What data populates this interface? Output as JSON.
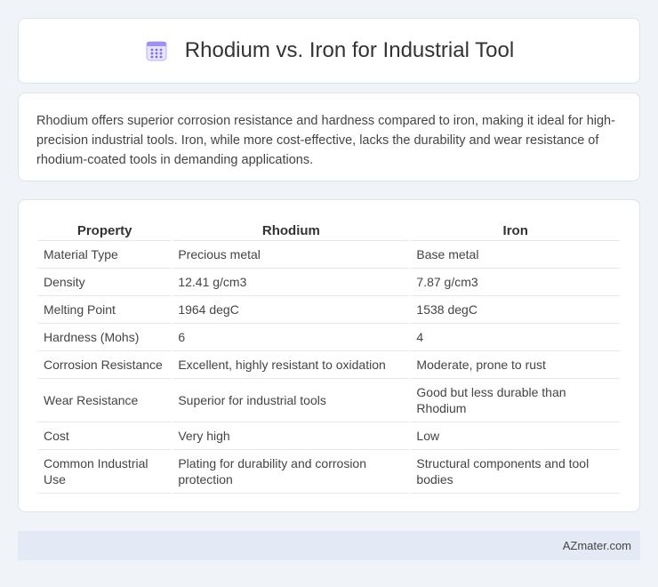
{
  "header": {
    "title": "Rhodium vs. Iron for Industrial Tool",
    "icon": "calendar-grid-icon",
    "icon_color": "#7a6cf0"
  },
  "summary": {
    "text": "Rhodium offers superior corrosion resistance and hardness compared to iron, making it ideal for high-precision industrial tools. Iron, while more cost-effective, lacks the durability and wear resistance of rhodium-coated tools in demanding applications."
  },
  "table": {
    "headers": [
      "Property",
      "Rhodium",
      "Iron"
    ],
    "rows": [
      [
        "Material Type",
        "Precious metal",
        "Base metal"
      ],
      [
        "Density",
        "12.41 g/cm3",
        "7.87 g/cm3"
      ],
      [
        "Melting Point",
        "1964 degC",
        "1538 degC"
      ],
      [
        "Hardness (Mohs)",
        "6",
        "4"
      ],
      [
        "Corrosion Resistance",
        "Excellent, highly resistant to oxidation",
        "Moderate, prone to rust"
      ],
      [
        "Wear Resistance",
        "Superior for industrial tools",
        "Good but less durable than Rhodium"
      ],
      [
        "Cost",
        "Very high",
        "Low"
      ],
      [
        "Common Industrial Use",
        "Plating for durability and corrosion protection",
        "Structural components and tool bodies"
      ]
    ]
  },
  "footer": {
    "brand": "AZmater.com"
  }
}
